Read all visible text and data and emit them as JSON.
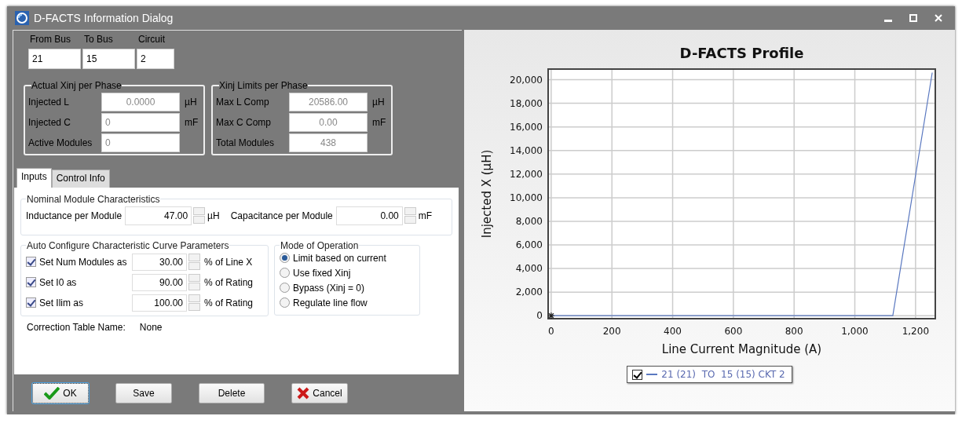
{
  "window": {
    "title": "D-FACTS Information Dialog"
  },
  "branch": [
    {
      "label": "From Bus",
      "value": "21"
    },
    {
      "label": "To Bus",
      "value": "15"
    },
    {
      "label": "Circuit",
      "value": "2"
    }
  ],
  "groups": [
    {
      "title": "Actual Xinj per Phase",
      "rows": [
        {
          "label": "Injected L",
          "value": "0.0000",
          "unit": "µH",
          "disabled": true
        },
        {
          "label": "Injected C",
          "value": "0",
          "unit": "mF",
          "disabled": true
        },
        {
          "label": "Active Modules",
          "value": "0",
          "disabled": true
        }
      ]
    },
    {
      "title": "Xinj Limits per Phase",
      "rows": [
        {
          "label": "Max L Comp",
          "value": "20586.00",
          "unit": "µH",
          "disabled": true
        },
        {
          "label": "Max C Comp",
          "value": "0.00",
          "unit": "mF",
          "disabled": true
        },
        {
          "label": "Total Modules",
          "value": "438",
          "disabled": true
        }
      ]
    }
  ],
  "tabs": [
    {
      "label": "Inputs",
      "selected": true
    },
    {
      "label": "Control Info",
      "selected": false
    }
  ],
  "nominal": {
    "title": "Nominal Module Characteristics",
    "fields": [
      {
        "label": "Inductance per Module",
        "value": "47.00",
        "unit": "µH"
      },
      {
        "label": "Capacitance per Module",
        "value": "0.00",
        "unit": "mF"
      }
    ]
  },
  "auto_configure": {
    "title": "Auto Configure Characteristic Curve Parameters",
    "rows": [
      {
        "label": "Set Num Modules as",
        "checked": true,
        "value": "30.00",
        "unit": "% of Line X"
      },
      {
        "label": "Set I0 as",
        "checked": true,
        "value": "90.00",
        "unit": "% of Rating"
      },
      {
        "label": "Set Ilim as",
        "checked": true,
        "value": "100.00",
        "unit": "% of Rating"
      }
    ]
  },
  "mode": {
    "title": "Mode of Operation",
    "options": [
      {
        "label": "Limit based on current",
        "selected": true
      },
      {
        "label": "Use fixed Xinj",
        "selected": false
      },
      {
        "label": "Bypass (Xinj = 0)",
        "selected": false
      },
      {
        "label": "Regulate line flow",
        "selected": false
      }
    ]
  },
  "correction": {
    "label": "Correction Table Name:",
    "value": "None"
  },
  "buttons": [
    {
      "label": "OK",
      "kind": "ok"
    },
    {
      "label": "Save",
      "kind": "plain"
    },
    {
      "label": "Delete",
      "kind": "plain"
    },
    {
      "label": "Cancel",
      "kind": "cancel"
    }
  ],
  "chart": {
    "chart_data": {
      "type": "line",
      "title": "D-FACTS Profile",
      "xlabel": "Line Current Magnitude (A)",
      "ylabel": "Injected X (µH)",
      "series": [
        {
          "name": "21 (21)  TO  15 (15) CKT 2",
          "color": "#5a78c0",
          "x": [
            0,
            1125,
            1255
          ],
          "values": [
            0,
            0,
            20600
          ]
        }
      ],
      "grid": true,
      "xlim": [
        -10,
        1265
      ],
      "ylim": [
        -250,
        20900
      ],
      "xticks": [
        {
          "value": 0,
          "label": "0"
        },
        {
          "value": 200,
          "label": "200"
        },
        {
          "value": 400,
          "label": "400"
        },
        {
          "value": 600,
          "label": "600"
        },
        {
          "value": 800,
          "label": "800"
        },
        {
          "value": 1000,
          "label": "1,000"
        },
        {
          "value": 1200,
          "label": "1,200"
        }
      ],
      "yticks": [
        {
          "value": 0,
          "label": "0"
        },
        {
          "value": 2000,
          "label": "2,000"
        },
        {
          "value": 4000,
          "label": "4,000"
        },
        {
          "value": 6000,
          "label": "6,000"
        },
        {
          "value": 8000,
          "label": "8,000"
        },
        {
          "value": 10000,
          "label": "10,000"
        },
        {
          "value": 12000,
          "label": "12,000"
        },
        {
          "value": 14000,
          "label": "14,000"
        },
        {
          "value": 16000,
          "label": "16,000"
        },
        {
          "value": 18000,
          "label": "18,000"
        },
        {
          "value": 20000,
          "label": "20,000"
        }
      ]
    },
    "legend": {
      "checked": true
    }
  }
}
